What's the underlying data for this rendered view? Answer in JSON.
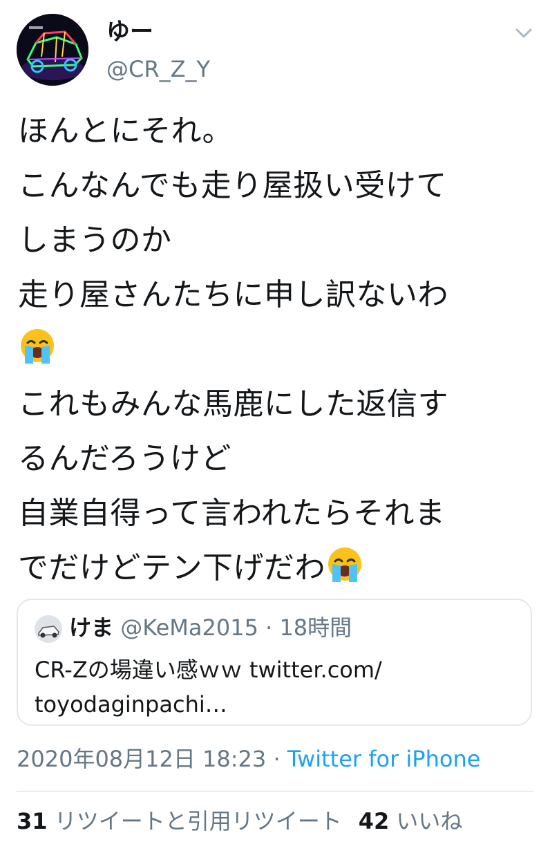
{
  "tweet": {
    "author_name": "ゆー",
    "author_handle": "@CR_Z_Y",
    "lines": [
      "ほんとにそれ。",
      "こんなんでも走り屋扱い受けて",
      "しまうのか",
      "走り屋さんたちに申し訳ないわ",
      "",
      "これもみんな馬鹿にした返信す",
      "るんだろうけど",
      "自業自得って言われたらそれま",
      "でだけどテン下げだわ"
    ],
    "emoji_icon": "loudly-crying-face",
    "timestamp": "2020年08月12日 18:23",
    "separator": " · ",
    "source": "Twitter for iPhone"
  },
  "quote": {
    "name": "けま",
    "handle": "@KeMa2015",
    "time": "18時間",
    "separator": " · ",
    "text_lines": [
      "CR-Zの場違い感ｗｗ twitter.com/",
      "toyodaginpachi…"
    ]
  },
  "stats": {
    "retweets_count": "31",
    "retweets_label": "リツイートと引用リツイート",
    "likes_count": "42",
    "likes_label": "いいね"
  },
  "colors": {
    "accent": "#1da1f2",
    "secondary_text": "#657786",
    "primary_text": "#14171a",
    "border": "#e1e8ed"
  }
}
